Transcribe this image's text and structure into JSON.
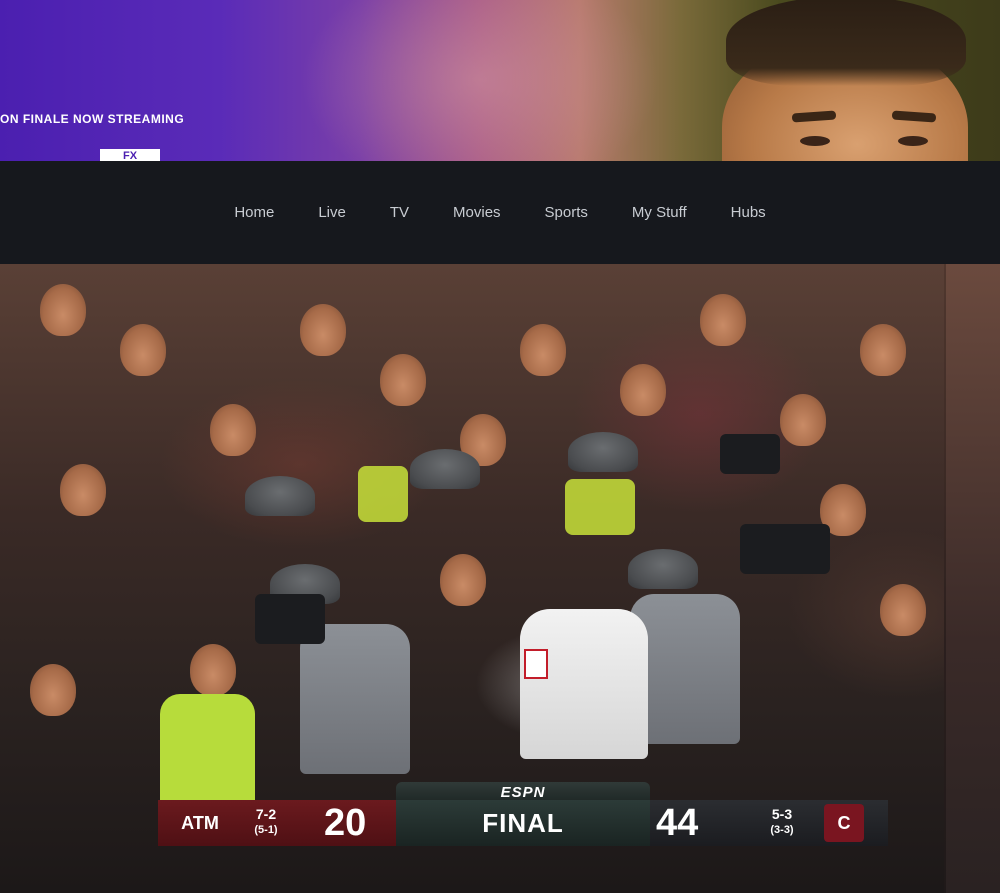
{
  "promo": {
    "tagline": "ON FINALE NOW STREAMING",
    "logo_text": "FX"
  },
  "nav": {
    "items": [
      {
        "label": "Home"
      },
      {
        "label": "Live"
      },
      {
        "label": "TV"
      },
      {
        "label": "Movies"
      },
      {
        "label": "Sports"
      },
      {
        "label": "My Stuff"
      },
      {
        "label": "Hubs"
      }
    ]
  },
  "scorebug": {
    "network": "ESPN",
    "status": "FINAL",
    "away": {
      "logo_text": "ATM",
      "record": "7-2",
      "conf_record": "(5-1)",
      "score": "20",
      "color": "#5c1418"
    },
    "home": {
      "logo_text": "C",
      "record": "5-3",
      "conf_record": "(3-3)",
      "score": "44",
      "color": "#7a1520"
    }
  }
}
